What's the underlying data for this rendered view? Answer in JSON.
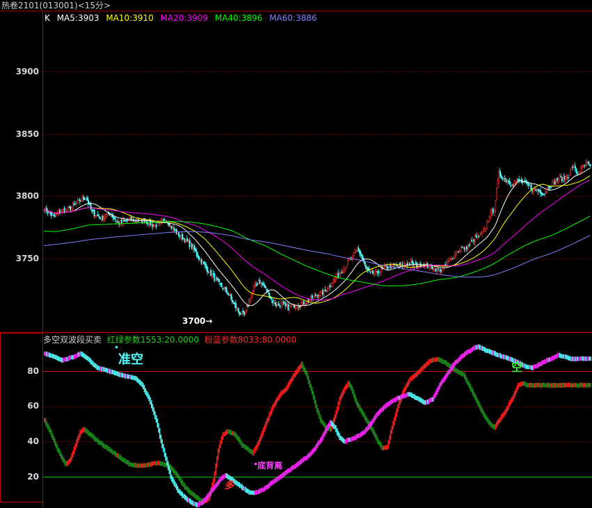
{
  "window": {
    "title": "热卷2101(013001)<15分>"
  },
  "main_panel": {
    "legend": {
      "k_label": "K",
      "items": [
        {
          "text": "MA5:3903",
          "color": "#ffffff"
        },
        {
          "text": "MA10:3910",
          "color": "#ffff00"
        },
        {
          "text": "MA20:3909",
          "color": "#ff00ff"
        },
        {
          "text": "MA40:3896",
          "color": "#00ff00"
        },
        {
          "text": "MA60:3886",
          "color": "#8080ff"
        }
      ]
    },
    "min_label": "3700→"
  },
  "indicator_panel": {
    "name": "多空双波段买卖",
    "red_green_param": "红绿参数1553:20.0000",
    "pink_blue_param": "粉蓝参数8033:80.0000",
    "annotations": {
      "quasi_short": "准空",
      "short": "空",
      "bottom_divergence": "底背离",
      "long": "多"
    }
  },
  "chart_data": [
    {
      "type": "candlestick",
      "title": "热卷2101(013001)<15分>",
      "xlabel": "",
      "ylabel": "",
      "y_ticks": [
        3750,
        3800,
        3850,
        3900
      ],
      "ylim": [
        3692,
        3940
      ],
      "grid": true,
      "colors": {
        "up": "#ff3232",
        "down": "#54ffff",
        "grid": "#b00000"
      },
      "price_path": [
        [
          0,
          3790
        ],
        [
          8,
          3783
        ],
        [
          14,
          3788
        ],
        [
          22,
          3790
        ],
        [
          30,
          3796
        ],
        [
          35,
          3799
        ],
        [
          40,
          3787
        ],
        [
          48,
          3782
        ],
        [
          55,
          3786
        ],
        [
          62,
          3778
        ],
        [
          70,
          3780
        ],
        [
          78,
          3781
        ],
        [
          85,
          3780
        ],
        [
          92,
          3776
        ],
        [
          98,
          3778
        ],
        [
          102,
          3782
        ],
        [
          106,
          3776
        ],
        [
          112,
          3770
        ],
        [
          118,
          3765
        ],
        [
          125,
          3758
        ],
        [
          130,
          3750
        ],
        [
          136,
          3742
        ],
        [
          142,
          3735
        ],
        [
          148,
          3728
        ],
        [
          154,
          3722
        ],
        [
          160,
          3712
        ],
        [
          164,
          3706
        ],
        [
          168,
          3704
        ],
        [
          172,
          3715
        ],
        [
          176,
          3726
        ],
        [
          180,
          3732
        ],
        [
          184,
          3728
        ],
        [
          188,
          3722
        ],
        [
          192,
          3715
        ],
        [
          196,
          3712
        ],
        [
          200,
          3713
        ],
        [
          205,
          3710
        ],
        [
          210,
          3712
        ],
        [
          216,
          3713
        ],
        [
          222,
          3716
        ],
        [
          228,
          3720
        ],
        [
          234,
          3722
        ],
        [
          240,
          3728
        ],
        [
          244,
          3733
        ],
        [
          248,
          3738
        ],
        [
          252,
          3742
        ],
        [
          256,
          3748
        ],
        [
          260,
          3752
        ],
        [
          263,
          3758
        ],
        [
          266,
          3752
        ],
        [
          270,
          3742
        ],
        [
          274,
          3737
        ],
        [
          278,
          3738
        ],
        [
          282,
          3740
        ],
        [
          288,
          3743
        ],
        [
          294,
          3744
        ],
        [
          300,
          3744
        ],
        [
          306,
          3746
        ],
        [
          312,
          3744
        ],
        [
          318,
          3745
        ],
        [
          324,
          3743
        ],
        [
          330,
          3741
        ],
        [
          334,
          3740
        ],
        [
          338,
          3745
        ],
        [
          342,
          3750
        ],
        [
          346,
          3754
        ],
        [
          350,
          3758
        ],
        [
          354,
          3758
        ],
        [
          358,
          3762
        ],
        [
          362,
          3766
        ],
        [
          366,
          3768
        ],
        [
          370,
          3772
        ],
        [
          374,
          3784
        ],
        [
          378,
          3790
        ],
        [
          382,
          3818
        ],
        [
          386,
          3814
        ],
        [
          392,
          3810
        ],
        [
          398,
          3812
        ],
        [
          404,
          3810
        ],
        [
          410,
          3806
        ],
        [
          416,
          3804
        ],
        [
          420,
          3802
        ],
        [
          424,
          3808
        ],
        [
          428,
          3810
        ],
        [
          432,
          3814
        ],
        [
          436,
          3814
        ],
        [
          440,
          3816
        ],
        [
          444,
          3824
        ],
        [
          448,
          3818
        ],
        [
          452,
          3823
        ],
        [
          456,
          3826
        ],
        [
          459,
          3823
        ]
      ],
      "moving_averages": [
        {
          "name": "MA5",
          "color": "#ffffff"
        },
        {
          "name": "MA10",
          "color": "#ffff00"
        },
        {
          "name": "MA20",
          "color": "#ff00ff"
        },
        {
          "name": "MA40",
          "color": "#00ff00"
        },
        {
          "name": "MA60",
          "color": "#8080ff"
        }
      ],
      "annotations": [
        {
          "text": "3700→",
          "value": 3704
        }
      ]
    },
    {
      "type": "bar",
      "title": "多空双波段买卖",
      "xlabel": "",
      "ylabel": "",
      "y_ticks": [
        20,
        40,
        60,
        80
      ],
      "ylim": [
        0,
        96
      ],
      "grid": true,
      "lines": [
        {
          "value": 80,
          "color": "#d01010"
        },
        {
          "value": 20,
          "color": "#00c000"
        }
      ],
      "series": [
        {
          "name": "红绿参数1553:20.0000",
          "colors": {
            "rising": "#ff2020",
            "falling": "#1c8c1c"
          },
          "path": [
            [
              0,
              52
            ],
            [
              5,
              45
            ],
            [
              10,
              37
            ],
            [
              15,
              30
            ],
            [
              18,
              27
            ],
            [
              22,
              30
            ],
            [
              26,
              38
            ],
            [
              30,
              45
            ],
            [
              33,
              47
            ],
            [
              38,
              44
            ],
            [
              45,
              40
            ],
            [
              55,
              35
            ],
            [
              65,
              30
            ],
            [
              72,
              27
            ],
            [
              80,
              26
            ],
            [
              88,
              27
            ],
            [
              95,
              28
            ],
            [
              105,
              26
            ],
            [
              112,
              20
            ],
            [
              118,
              14
            ],
            [
              124,
              10
            ],
            [
              130,
              7
            ],
            [
              135,
              6
            ],
            [
              138,
              8
            ],
            [
              142,
              18
            ],
            [
              146,
              35
            ],
            [
              150,
              44
            ],
            [
              154,
              46
            ],
            [
              160,
              44
            ],
            [
              166,
              38
            ],
            [
              172,
              35
            ],
            [
              175,
              33
            ],
            [
              180,
              40
            ],
            [
              186,
              50
            ],
            [
              192,
              60
            ],
            [
              198,
              67
            ],
            [
              203,
              70
            ],
            [
              208,
              76
            ],
            [
              214,
              82
            ],
            [
              216,
              84
            ],
            [
              220,
              78
            ],
            [
              224,
              70
            ],
            [
              228,
              60
            ],
            [
              232,
              52
            ],
            [
              236,
              48
            ],
            [
              240,
              47
            ],
            [
              244,
              54
            ],
            [
              248,
              64
            ],
            [
              252,
              70
            ],
            [
              255,
              73
            ],
            [
              258,
              70
            ],
            [
              262,
              62
            ],
            [
              268,
              55
            ],
            [
              274,
              48
            ],
            [
              280,
              40
            ],
            [
              284,
              36
            ],
            [
              288,
              37
            ],
            [
              292,
              48
            ],
            [
              296,
              58
            ],
            [
              300,
              66
            ],
            [
              304,
              72
            ],
            [
              308,
              76
            ],
            [
              312,
              78
            ],
            [
              318,
              82
            ],
            [
              324,
              86
            ],
            [
              330,
              87
            ],
            [
              336,
              85
            ],
            [
              342,
              82
            ],
            [
              346,
              80
            ],
            [
              352,
              78
            ],
            [
              358,
              70
            ],
            [
              364,
              62
            ],
            [
              370,
              54
            ],
            [
              374,
              50
            ],
            [
              378,
              48
            ],
            [
              382,
              52
            ],
            [
              388,
              58
            ],
            [
              394,
              66
            ],
            [
              398,
              72
            ],
            [
              402,
              73
            ],
            [
              406,
              72
            ]
          ]
        },
        {
          "name": "粉蓝参数8033:80.0000",
          "colors": {
            "rising": "#ff28ff",
            "falling": "#55ffff"
          },
          "path": [
            [
              0,
              90
            ],
            [
              8,
              88
            ],
            [
              15,
              86
            ],
            [
              24,
              88
            ],
            [
              30,
              90
            ],
            [
              36,
              87
            ],
            [
              44,
              82
            ],
            [
              54,
              80
            ],
            [
              62,
              78
            ],
            [
              70,
              77
            ],
            [
              76,
              76
            ],
            [
              82,
              72
            ],
            [
              88,
              64
            ],
            [
              94,
              52
            ],
            [
              98,
              40
            ],
            [
              102,
              30
            ],
            [
              106,
              20
            ],
            [
              112,
              12
            ],
            [
              118,
              8
            ],
            [
              124,
              5
            ],
            [
              128,
              4
            ],
            [
              132,
              5
            ],
            [
              136,
              8
            ],
            [
              140,
              12
            ],
            [
              144,
              15
            ],
            [
              148,
              19
            ],
            [
              152,
              21
            ],
            [
              158,
              18
            ],
            [
              164,
              15
            ],
            [
              168,
              13
            ],
            [
              172,
              11
            ],
            [
              178,
              11
            ],
            [
              184,
              13
            ],
            [
              190,
              16
            ],
            [
              196,
              19
            ],
            [
              202,
              22
            ],
            [
              208,
              25
            ],
            [
              214,
              28
            ],
            [
              220,
              31
            ],
            [
              226,
              35
            ],
            [
              232,
              41
            ],
            [
              236,
              46
            ],
            [
              240,
              51
            ],
            [
              244,
              48
            ],
            [
              248,
              42
            ],
            [
              252,
              40
            ],
            [
              260,
              42
            ],
            [
              268,
              45
            ],
            [
              274,
              50
            ],
            [
              280,
              56
            ],
            [
              286,
              60
            ],
            [
              292,
              63
            ],
            [
              298,
              65
            ],
            [
              306,
              67
            ],
            [
              314,
              64
            ],
            [
              320,
              62
            ],
            [
              326,
              64
            ],
            [
              332,
              72
            ],
            [
              338,
              78
            ],
            [
              344,
              84
            ],
            [
              350,
              88
            ],
            [
              354,
              90
            ],
            [
              358,
              92
            ],
            [
              364,
              94
            ],
            [
              370,
              92
            ],
            [
              378,
              90
            ],
            [
              386,
              88
            ],
            [
              394,
              86
            ],
            [
              400,
              84
            ],
            [
              406,
              82
            ],
            [
              410,
              82
            ],
            [
              416,
              84
            ],
            [
              422,
              86
            ],
            [
              428,
              88
            ],
            [
              432,
              89
            ],
            [
              438,
              88
            ],
            [
              441,
              87
            ]
          ]
        }
      ],
      "annotations": [
        {
          "text": "准空",
          "color": "#54ffff"
        },
        {
          "text": "空",
          "color": "#3ee53e"
        },
        {
          "text": "底背离",
          "color": "#ff40ff"
        },
        {
          "text": "多",
          "color": "#ff3030"
        }
      ]
    }
  ]
}
